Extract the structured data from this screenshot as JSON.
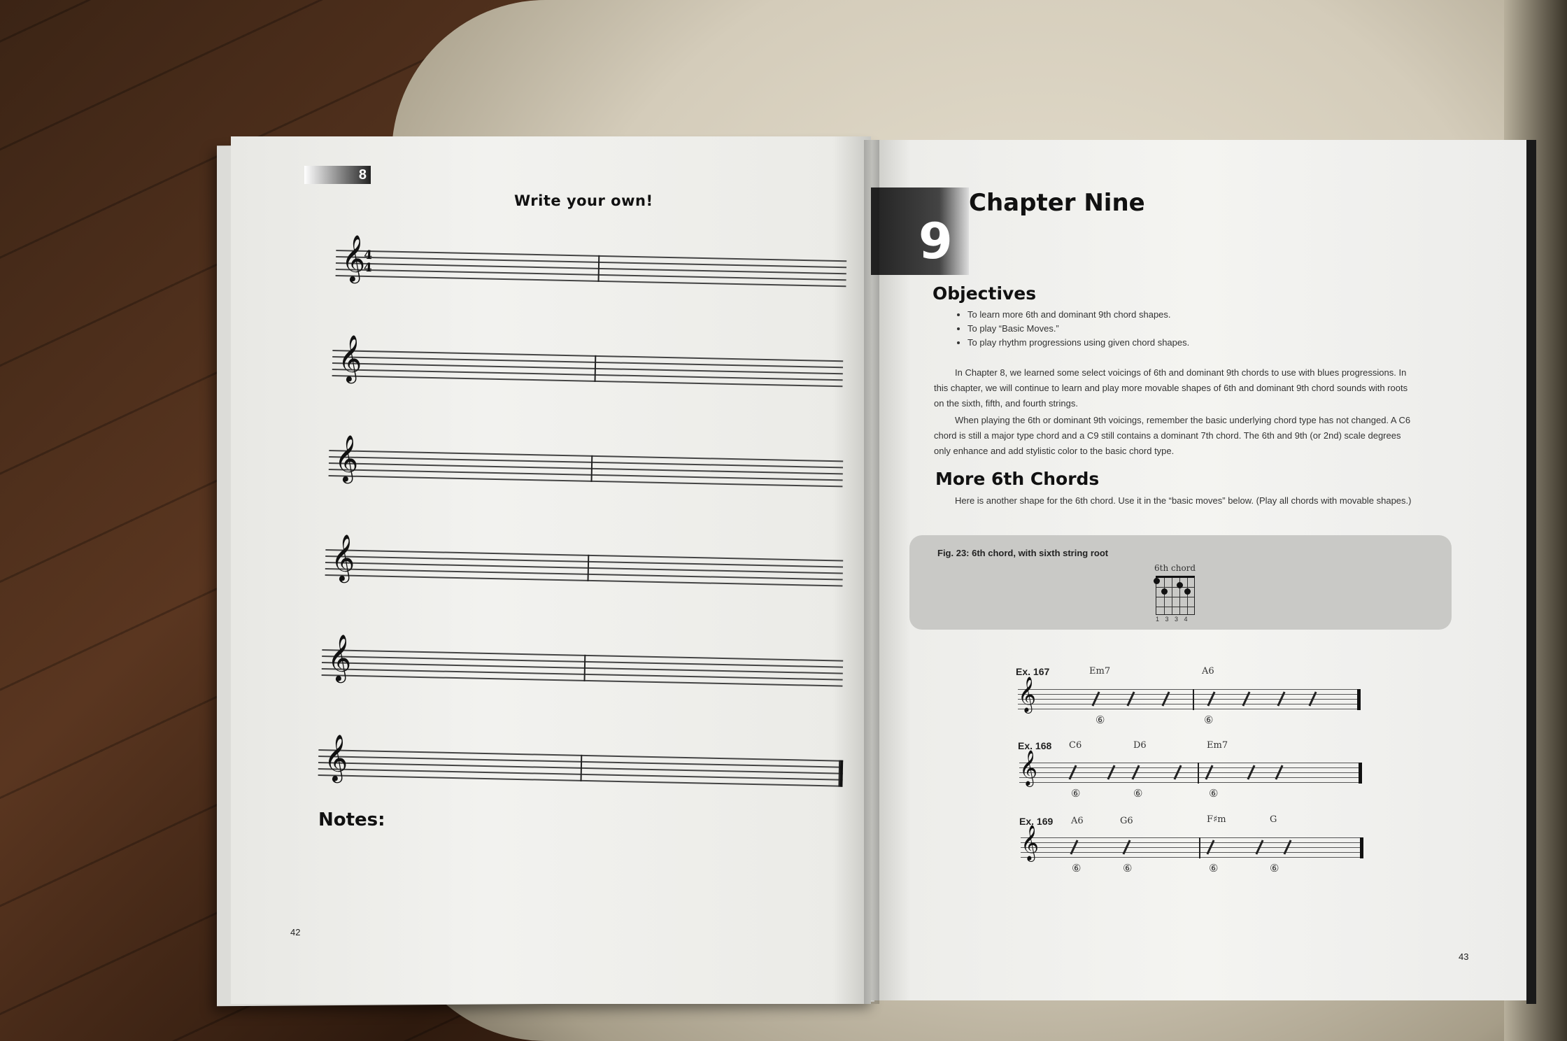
{
  "left_page": {
    "tab_number": "8",
    "title": "Write your own!",
    "time_signature_top": "4",
    "time_signature_bottom": "4",
    "notes_label": "Notes:",
    "page_number": "42"
  },
  "right_page": {
    "chapter_number": "9",
    "chapter_title": "Chapter Nine",
    "objectives_heading": "Objectives",
    "objectives": [
      "To learn more 6th and dominant 9th chord shapes.",
      "To play “Basic Moves.”",
      "To play rhythm progressions using given chord shapes."
    ],
    "para1": "In Chapter 8, we learned some select voicings of 6th and dominant 9th chords to use with blues progressions. In this chapter, we will continue to learn and play more movable shapes of 6th and dominant 9th chord sounds with roots on the sixth, fifth, and fourth strings.",
    "para2": "When playing the 6th or dominant 9th voicings, remember the basic underlying chord type has not changed. A C6 chord is still a major type chord and a C9 still contains a dominant 7th chord. The 6th and 9th (or 2nd) scale degrees only enhance and add stylistic color to the basic chord type.",
    "section_heading": "More 6th Chords",
    "section_text": "Here is another shape for the 6th chord. Use it in the “basic moves” below. (Play all chords with movable shapes.)",
    "figure_title": "Fig. 23: 6th chord, with sixth string root",
    "figure_chord_label": "6th chord",
    "figure_fingering": "1 3 3 4",
    "examples": [
      {
        "label": "Ex. 167",
        "chords": [
          "Em7",
          "A6"
        ],
        "strings": [
          "⑥",
          "⑥"
        ]
      },
      {
        "label": "Ex. 168",
        "chords": [
          "C6",
          "D6",
          "Em7"
        ],
        "strings": [
          "⑥",
          "⑥",
          "⑥"
        ]
      },
      {
        "label": "Ex. 169",
        "chords": [
          "A6",
          "G6",
          "F♯m",
          "G"
        ],
        "strings": [
          "⑥",
          "⑥",
          "⑥",
          "⑥"
        ]
      }
    ],
    "page_number": "43"
  }
}
